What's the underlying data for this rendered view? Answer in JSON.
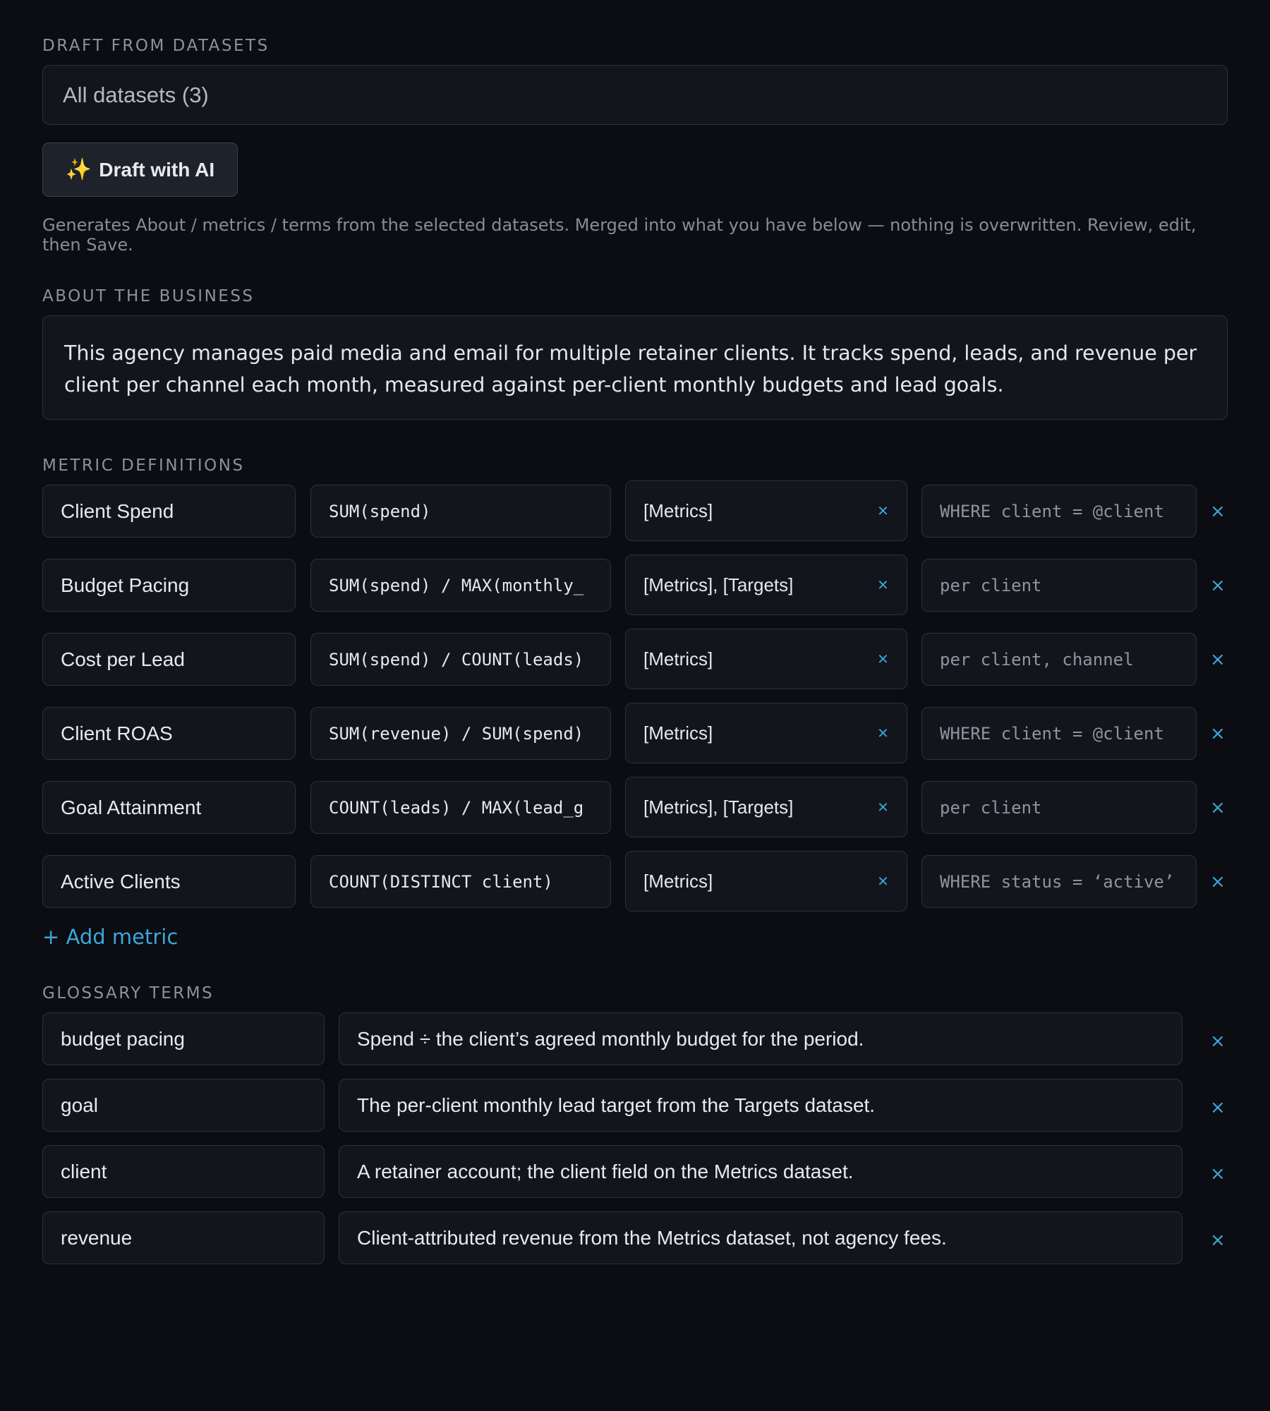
{
  "draft_section": {
    "label": "DRAFT FROM DATASETS",
    "dataset_select_value": "All datasets (3)",
    "draft_button_icon": "sparkles-icon",
    "draft_button_icon_glyph": "✨",
    "draft_button_label": "Draft with AI",
    "help_text": "Generates About / metrics / terms from the selected datasets. Merged into what you have below — nothing is overwritten. Review, edit, then Save."
  },
  "about_section": {
    "label": "ABOUT THE BUSINESS",
    "text": "This agency manages paid media and email for multiple retainer clients. It tracks spend, leads, and revenue per client per channel each month, measured against per-client monthly budgets and lead goals."
  },
  "metrics_section": {
    "label": "METRIC DEFINITIONS",
    "remove_glyph": "×",
    "items": [
      {
        "name": "Client Spend",
        "formula": "SUM(spend)",
        "datasets": "[Metrics]",
        "filter": "WHERE client = @client"
      },
      {
        "name": "Budget Pacing",
        "formula": "SUM(spend) / MAX(monthly_",
        "datasets": "[Metrics], [Targets]",
        "filter": "per client"
      },
      {
        "name": "Cost per Lead",
        "formula": "SUM(spend) / COUNT(leads)",
        "datasets": "[Metrics]",
        "filter": "per client, channel"
      },
      {
        "name": "Client ROAS",
        "formula": "SUM(revenue) / SUM(spend)",
        "datasets": "[Metrics]",
        "filter": "WHERE client = @client"
      },
      {
        "name": "Goal Attainment",
        "formula": "COUNT(leads) / MAX(lead_g",
        "datasets": "[Metrics], [Targets]",
        "filter": "per client"
      },
      {
        "name": "Active Clients",
        "formula": "COUNT(DISTINCT client)",
        "datasets": "[Metrics]",
        "filter": "WHERE status = ‘active’"
      }
    ],
    "add_label": "+ Add metric"
  },
  "glossary_section": {
    "label": "GLOSSARY TERMS",
    "items": [
      {
        "term": "budget pacing",
        "definition": "Spend ÷ the client’s agreed monthly budget for the period."
      },
      {
        "term": "goal",
        "definition": "The per-client monthly lead target from the Targets dataset."
      },
      {
        "term": "client",
        "definition": "A retainer account; the client field on the Metrics dataset."
      },
      {
        "term": "revenue",
        "definition": "Client-attributed revenue from the Metrics dataset, not agency fees."
      }
    ]
  },
  "colors": {
    "background": "#0b0d12",
    "field_background": "#12151c",
    "accent": "#3ba7d8",
    "sparkle": "#f4b544"
  }
}
